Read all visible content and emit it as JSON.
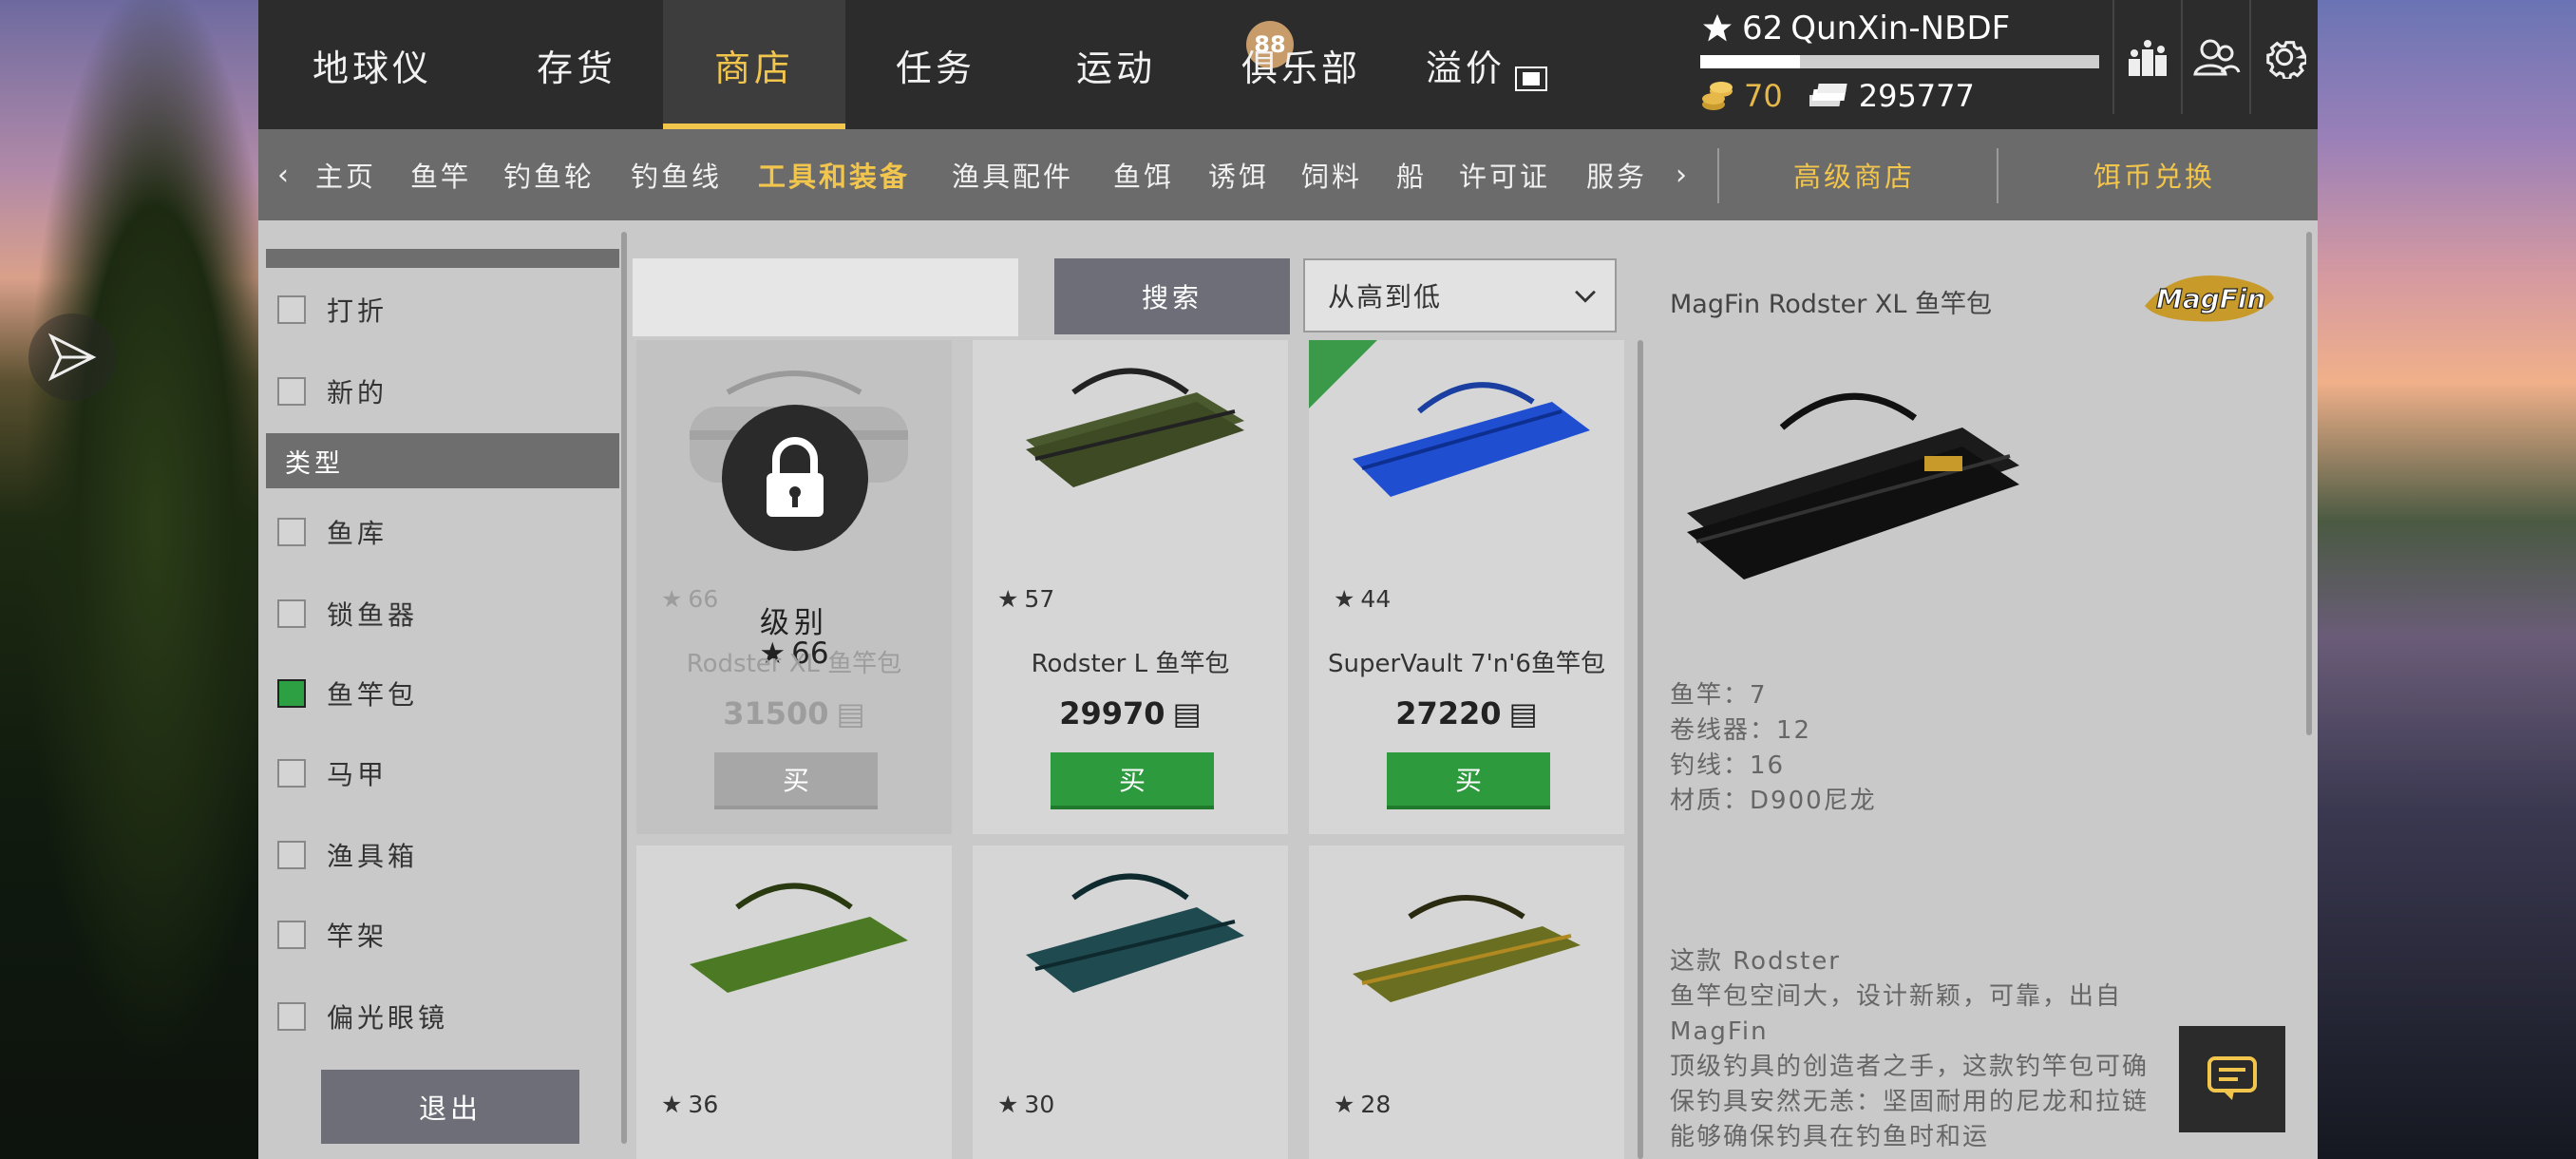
{
  "top_tabs": [
    {
      "label": "地球仪"
    },
    {
      "label": "存货"
    },
    {
      "label": "商店"
    },
    {
      "label": "任务"
    },
    {
      "label": "运动"
    },
    {
      "label": "俱乐部"
    },
    {
      "label": "溢价"
    }
  ],
  "tasks_badge": "88",
  "player": {
    "level": "62",
    "name": "QunXin-NBDF",
    "gold": "70",
    "cash": "295777"
  },
  "sub_nav": {
    "items": [
      "主页",
      "鱼竿",
      "钓鱼轮",
      "钓鱼线",
      "工具和装备",
      "渔具配件",
      "鱼饵",
      "诱饵",
      "饲料",
      "船",
      "许可证",
      "服务"
    ],
    "active": "工具和装备",
    "premium_shop": "高级商店",
    "bait_exchange": "饵币兑换"
  },
  "filters": {
    "status_items": [
      {
        "label": "打折",
        "checked": false
      },
      {
        "label": "新的",
        "checked": false
      }
    ],
    "type_header": "类型",
    "type_items": [
      {
        "label": "鱼库",
        "checked": false
      },
      {
        "label": "锁鱼器",
        "checked": false
      },
      {
        "label": "鱼竿包",
        "checked": true
      },
      {
        "label": "马甲",
        "checked": false
      },
      {
        "label": "渔具箱",
        "checked": false
      },
      {
        "label": "竿架",
        "checked": false
      },
      {
        "label": "偏光眼镜",
        "checked": false
      }
    ],
    "exit_label": "退出"
  },
  "search": {
    "placeholder": "",
    "button_label": "搜索"
  },
  "sort": {
    "selected": "从高到低"
  },
  "products": [
    {
      "level": "66",
      "name": "Rodster XL 鱼竿包",
      "price": "31500",
      "buy_label": "买",
      "locked": true,
      "lock_label": "级别",
      "lock_level": "66",
      "color": "#9a9a9a"
    },
    {
      "level": "57",
      "name": "Rodster L 鱼竿包",
      "price": "29970",
      "buy_label": "买",
      "locked": false,
      "color": "#4b5a2e"
    },
    {
      "level": "44",
      "name": "SuperVault 7'n'6鱼竿包",
      "price": "27220",
      "buy_label": "买",
      "locked": false,
      "color": "#1f4fd0",
      "corner_badge": true
    },
    {
      "level": "36",
      "locked": false,
      "color": "#4c7a24"
    },
    {
      "level": "30",
      "locked": false,
      "color": "#1f4a50"
    },
    {
      "level": "28",
      "locked": false,
      "color": "#6a6e20"
    }
  ],
  "detail": {
    "title": "MagFin Rodster XL 鱼竿包",
    "brand": "MagFin",
    "specs": [
      "鱼竿：7",
      "卷线器：12",
      "钓线：16",
      "材质：D900尼龙"
    ],
    "description": "这款 Rodster\n鱼竿包空间大，设计新颖，可靠，出自 MagFin\n顶级钓具的创造者之手，这款钓竿包可确保钓具安然无恙：坚固耐用的尼龙和拉链能够确保钓具在钓鱼时和运"
  }
}
